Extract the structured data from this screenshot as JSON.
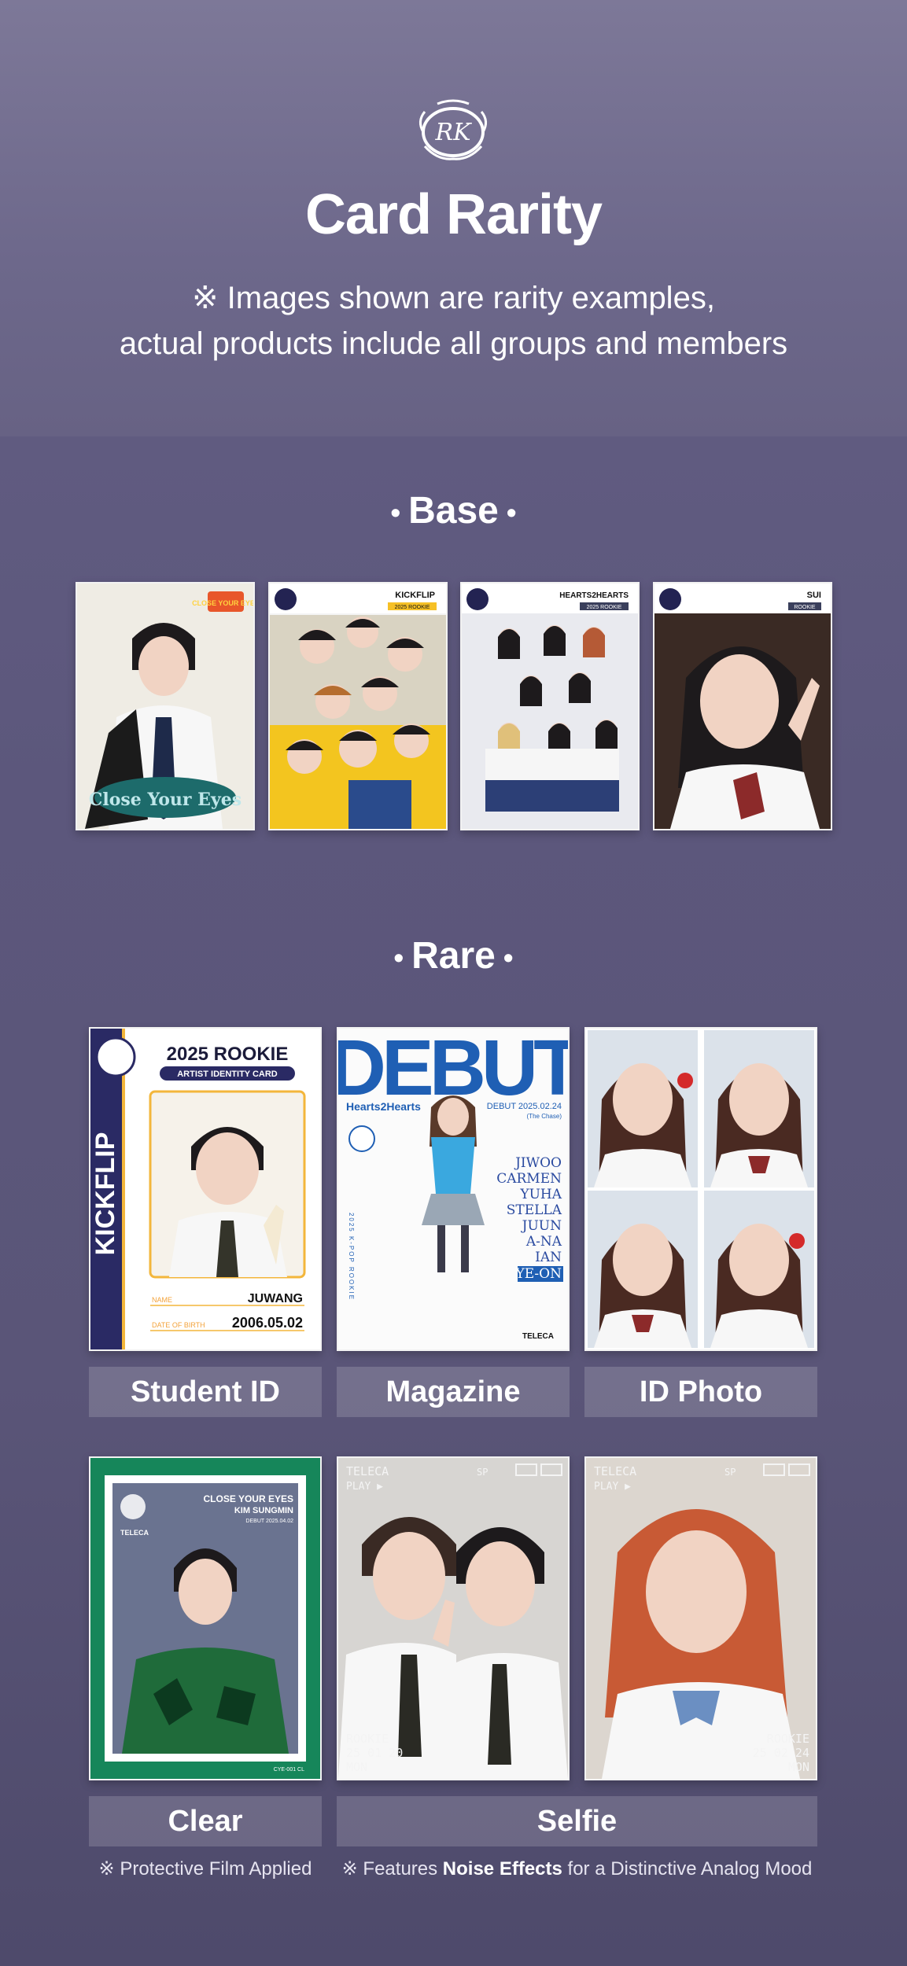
{
  "header": {
    "logo_text": "RK",
    "title": "Card Rarity",
    "subtitle_line1": "※ Images shown are rarity examples,",
    "subtitle_line2": "actual products include all groups and members"
  },
  "base": {
    "title": "Base",
    "cards": [
      {
        "name": "close-your-eyes",
        "top_text": "CLOSE YOUR EYES",
        "bottom_text": "Close Your Eyes"
      },
      {
        "name": "kickflip",
        "group": "KICKFLIP",
        "tag": "2025 ROOKIE"
      },
      {
        "name": "hearts2hearts",
        "group": "HEARTS2HEARTS",
        "tag": "2025 ROOKIE"
      },
      {
        "name": "sui",
        "group": "SUI",
        "tag": "ROOKIE"
      }
    ]
  },
  "rare": {
    "title": "Rare",
    "student_id": {
      "label": "Student ID",
      "heading": "2025 ROOKIE",
      "subheading": "ARTIST IDENTITY CARD",
      "side_text": "KICKFLIP",
      "name_label": "NAME",
      "name_value": "JUWANG",
      "dob_label": "DATE OF BIRTH",
      "dob_value": "2006.05.02"
    },
    "magazine": {
      "label": "Magazine",
      "masthead": "DEBUT",
      "group": "Hearts2Hearts",
      "date": "DEBUT 2025.02.24",
      "subdate": "(The Chase)",
      "members": [
        "JIWOO",
        "CARMEN",
        "YUHA",
        "STELLA",
        "JUUN",
        "A-NA",
        "IAN",
        "YE-ON"
      ],
      "side_text": "2025 K-POP ROOKIE",
      "brand": "TELECA"
    },
    "id_photo": {
      "label": "ID Photo"
    },
    "clear": {
      "label": "Clear",
      "line1": "CLOSE YOUR EYES",
      "line2": "KIM SUNGMIN",
      "line3": "DEBUT 2025.04.02",
      "brand": "TELECA",
      "code": "CYE-001 CL",
      "note": "※ Protective Film Applied"
    },
    "selfie": {
      "label": "Selfie",
      "card1": {
        "brand": "TELECA",
        "play": "PLAY ▶",
        "sp": "SP",
        "stamp1": "ROOKIE",
        "stamp2": "25 01 20",
        "stamp3": "MON"
      },
      "card2": {
        "brand": "TELECA",
        "play": "PLAY ▶",
        "sp": "SP",
        "stamp1": "ROOKIE",
        "stamp2": "25 02 24",
        "stamp3": "MON"
      },
      "note_prefix": "※ Features ",
      "note_bold": "Noise Effects",
      "note_suffix": " for a Distinctive Analog Mood"
    }
  }
}
